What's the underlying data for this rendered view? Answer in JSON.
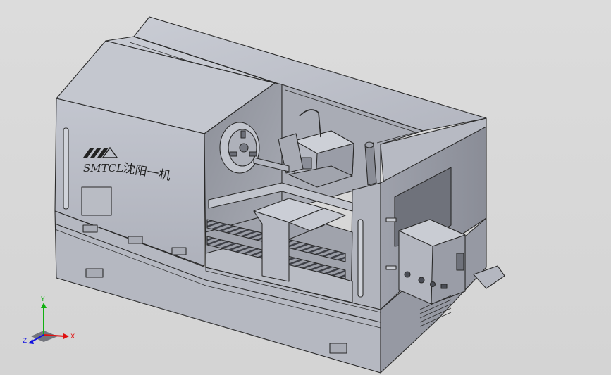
{
  "model": {
    "brand_text": "SMTCL",
    "brand_cn": "沈阳一机"
  },
  "triad": {
    "x_label": "X",
    "y_label": "Y",
    "z_label": "Z",
    "x_color": "#e01010",
    "y_color": "#10b010",
    "z_color": "#1010e0"
  },
  "colors": {
    "body": "#b9bcc6",
    "body_dark": "#8f939e",
    "body_light": "#cfd2da",
    "edge": "#2a2a2a"
  }
}
